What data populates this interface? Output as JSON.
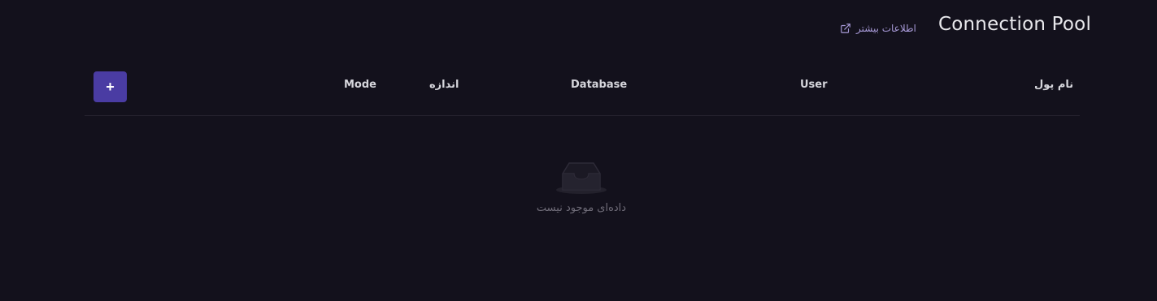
{
  "header": {
    "title": "Connection Pool",
    "more_info_label": "اطلاعات بیشتر",
    "more_info_icon": "external-link-icon"
  },
  "toolbar": {
    "add_label": "+"
  },
  "table": {
    "columns": [
      "نام پول",
      "User",
      "Database",
      "اندازه",
      "Mode"
    ],
    "rows": []
  },
  "empty_state": {
    "icon": "inbox-icon",
    "message": "داده‌ای موجود نیست"
  },
  "colors": {
    "background": "#13111c",
    "accent": "#4a3ca3",
    "link": "#a89ad8"
  }
}
